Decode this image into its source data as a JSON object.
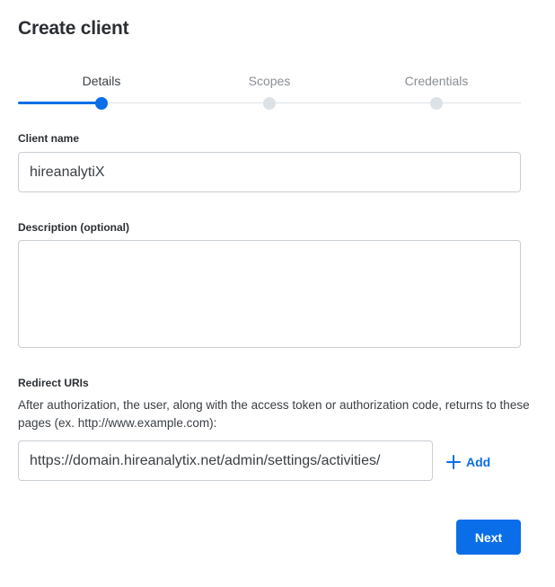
{
  "page": {
    "title": "Create client"
  },
  "stepper": {
    "steps": [
      {
        "label": "Details",
        "state": "active"
      },
      {
        "label": "Scopes",
        "state": "pending"
      },
      {
        "label": "Credentials",
        "state": "pending"
      }
    ]
  },
  "form": {
    "client_name": {
      "label": "Client name",
      "value": "hireanalytiX"
    },
    "description": {
      "label": "Description (optional)",
      "value": ""
    },
    "redirect_uris": {
      "label": "Redirect URIs",
      "help": "After authorization, the user, along with the access token or authorization code, returns to these pages (ex. http://www.example.com):",
      "value": "https://domain.hireanalytix.net/admin/settings/activities/",
      "add_label": "Add"
    }
  },
  "actions": {
    "next_label": "Next"
  },
  "colors": {
    "accent": "#0a6ee8",
    "inactive": "#dde2e7",
    "border": "#c9ced4"
  }
}
